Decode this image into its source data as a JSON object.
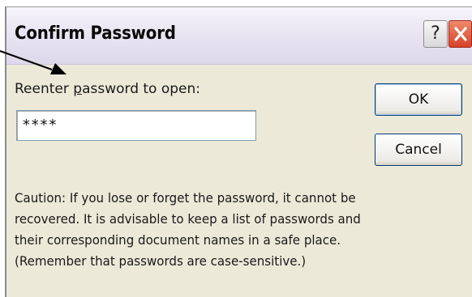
{
  "window": {
    "title": "Confirm Password",
    "help_glyph": "?",
    "help_icon": "question-mark-icon",
    "close_icon": "close-x-icon"
  },
  "form": {
    "prompt_before": "Reenter ",
    "prompt_accel": "p",
    "prompt_after": "assword to open:",
    "password_value": "****"
  },
  "buttons": {
    "ok_label": "OK",
    "cancel_label": "Cancel"
  },
  "caution": {
    "lines": [
      "Caution: If you lose or forget the password, it cannot be",
      "recovered. It is advisable to keep a list of passwords and",
      "their corresponding document names in a safe place.",
      "(Remember that passwords are case-sensitive.)"
    ]
  },
  "annotation": {
    "arrow_icon": "pointer-arrow-icon"
  },
  "colors": {
    "dialog_bg": "#ece9d8",
    "titlebar_bg": "#e9e5f2",
    "close_red": "#d6412a",
    "button_border": "#003c74"
  }
}
